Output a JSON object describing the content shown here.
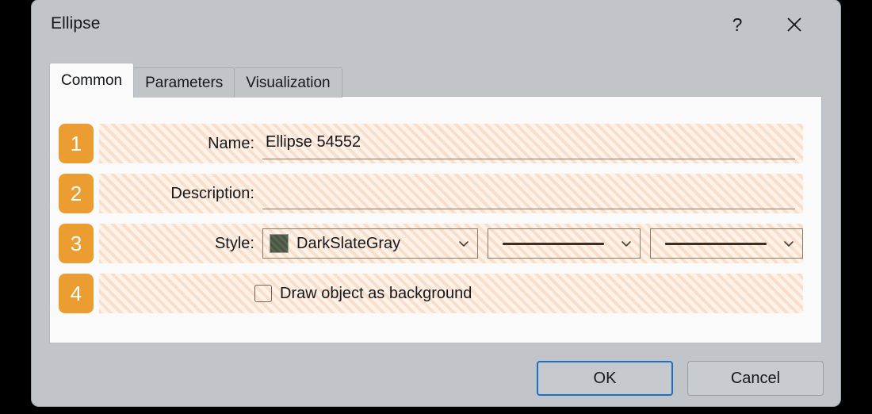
{
  "window": {
    "title": "Ellipse",
    "help_icon": "question-mark-icon",
    "close_icon": "close-x-icon",
    "chrome_color": "#c1c4c8"
  },
  "tabs": [
    {
      "label": "Common",
      "active": true
    },
    {
      "label": "Parameters",
      "active": false
    },
    {
      "label": "Visualization",
      "active": false
    }
  ],
  "panel": {
    "background_color": "#fafafa",
    "highlight_color": "#fbe7d6",
    "badge_color": "#eb9d32"
  },
  "rows": [
    {
      "badge": "1",
      "label": "Name:",
      "value": "Ellipse 54552",
      "placeholder": ""
    },
    {
      "badge": "2",
      "label": "Description:",
      "value": "",
      "placeholder": ""
    },
    {
      "badge": "3",
      "label": "Style:",
      "style_value": "DarkSlateGray",
      "swatch_color": "#4c5a4c",
      "line_style_1": "solid",
      "line_style_2": "solid"
    },
    {
      "badge": "4",
      "checkbox_label": "Draw object as background",
      "checked": false
    }
  ],
  "footer": {
    "ok_label": "OK",
    "cancel_label": "Cancel",
    "focus_color": "#1b6fc4"
  }
}
